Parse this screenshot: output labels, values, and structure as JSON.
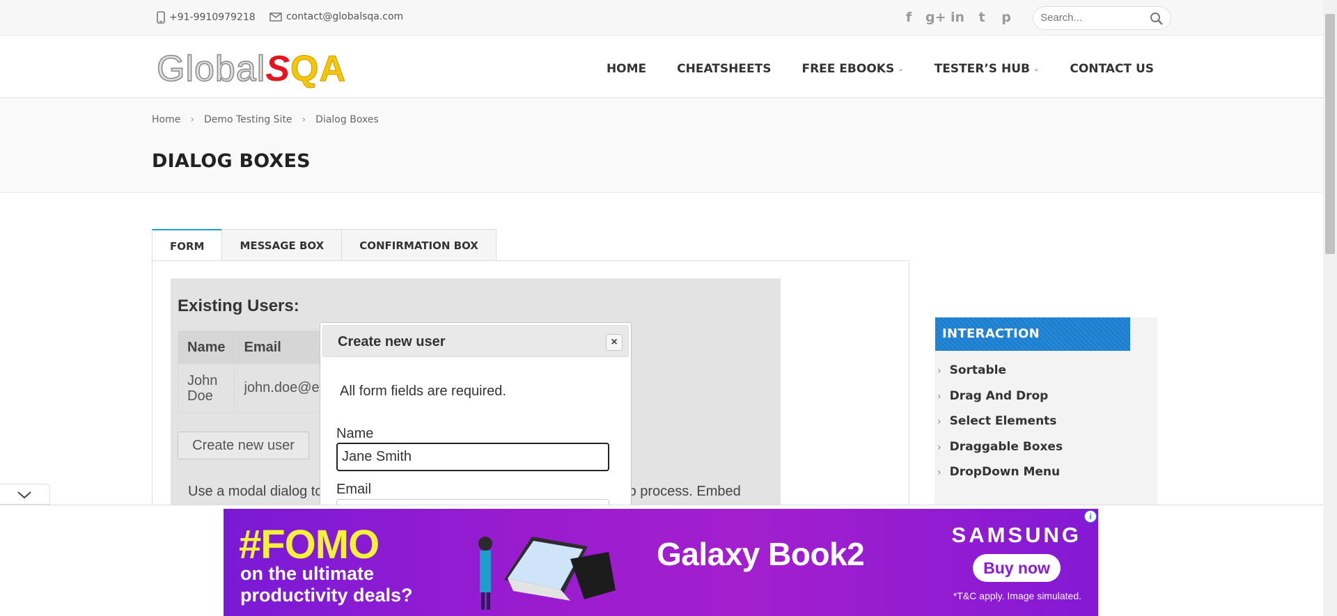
{
  "topbar": {
    "phone": "+91-9910979218",
    "email": "contact@globalsqa.com",
    "social": [
      "f",
      "g+",
      "in",
      "t",
      "p"
    ],
    "search_placeholder": "Search..."
  },
  "logo": {
    "part1": "Global",
    "part2": "S",
    "part3": "QA"
  },
  "nav": {
    "items": [
      {
        "label": "HOME",
        "caret": false
      },
      {
        "label": "CHEATSHEETS",
        "caret": false
      },
      {
        "label": "FREE EBOOKS",
        "caret": true
      },
      {
        "label": "TESTER’S HUB",
        "caret": true
      },
      {
        "label": "CONTACT US",
        "caret": false
      }
    ]
  },
  "breadcrumb": [
    "Home",
    "Demo Testing Site",
    "Dialog Boxes"
  ],
  "page_title": "DIALOG BOXES",
  "tabs": [
    "FORM",
    "MESSAGE BOX",
    "CONFIRMATION BOX"
  ],
  "demo": {
    "heading": "Existing Users:",
    "columns": [
      "Name",
      "Email"
    ],
    "row": {
      "name": "John Doe",
      "email": "john.doe@e"
    },
    "create_button": "Create new user",
    "description": "Use a modal dialog to require that the user enter data during a multi-step process. Embed"
  },
  "dialog": {
    "title": "Create new user",
    "close": "×",
    "note": "All form fields are required.",
    "name_label": "Name",
    "name_value": "Jane Smith",
    "email_label": "Email"
  },
  "sidebar": {
    "heading": "INTERACTION",
    "items": [
      "Sortable",
      "Drag And Drop",
      "Select Elements",
      "Draggable Boxes",
      "DropDown Menu"
    ]
  },
  "ad": {
    "headline": "#FOMO",
    "sub1": "on the ultimate",
    "sub2": "productivity deals?",
    "product": "Galaxy Book2",
    "brand": "SAMSUNG",
    "cta": "Buy now",
    "disclaimer": "*T&C apply. Image simulated."
  },
  "colors": {
    "accent": "#1e9ed6",
    "sidebar_head": "#1a7fcf",
    "ad_bg": "#8f1bd0",
    "logo_s": "#e3161f",
    "logo_qa": "#f7c600"
  }
}
